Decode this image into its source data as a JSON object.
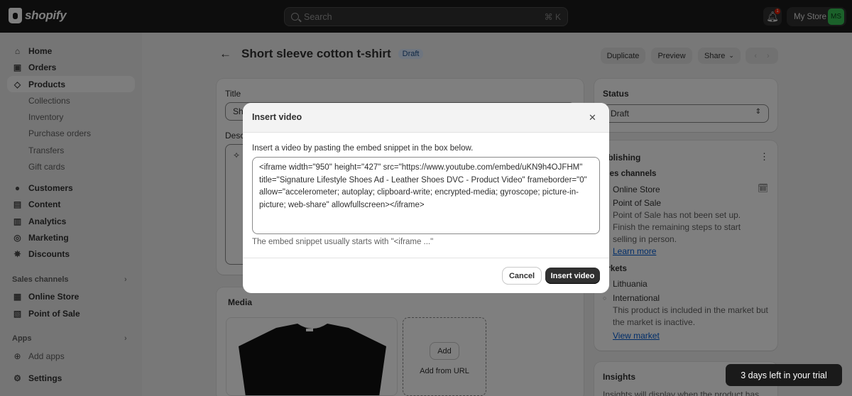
{
  "topbar": {
    "brand": "shopify",
    "search_placeholder": "Search",
    "search_shortcut": "⌘ K",
    "notification_count": "1",
    "store_name": "My Store",
    "store_initials": "MS"
  },
  "sidebar": {
    "items": [
      {
        "label": "Home",
        "icon": "home-icon"
      },
      {
        "label": "Orders",
        "icon": "orders-icon"
      },
      {
        "label": "Products",
        "icon": "tag-icon"
      },
      {
        "label": "Collections"
      },
      {
        "label": "Inventory"
      },
      {
        "label": "Purchase orders"
      },
      {
        "label": "Transfers"
      },
      {
        "label": "Gift cards"
      },
      {
        "label": "Customers",
        "icon": "person-icon"
      },
      {
        "label": "Content",
        "icon": "content-icon"
      },
      {
        "label": "Analytics",
        "icon": "analytics-icon"
      },
      {
        "label": "Marketing",
        "icon": "target-icon"
      },
      {
        "label": "Discounts",
        "icon": "discount-icon"
      }
    ],
    "sales_channels_label": "Sales channels",
    "channels": [
      {
        "label": "Online Store",
        "icon": "store-icon"
      },
      {
        "label": "Point of Sale",
        "icon": "pos-icon"
      }
    ],
    "apps_label": "Apps",
    "add_apps": "Add apps",
    "settings": "Settings"
  },
  "page": {
    "title": "Short sleeve cotton t-shirt",
    "status_badge": "Draft",
    "duplicate": "Duplicate",
    "preview": "Preview",
    "share": "Share"
  },
  "product_card": {
    "title_label": "Title",
    "title_value_partial": "Sh",
    "description_label_partial": "Desc",
    "media_label": "Media",
    "add_button": "Add",
    "add_from_url": "Add from URL"
  },
  "status_card": {
    "label": "Status",
    "value": "Draft"
  },
  "publishing_card": {
    "label_partial": "ublishing",
    "sales_channels_partial": "ales channels",
    "online_store": "Online Store",
    "point_of_sale": "Point of Sale",
    "pos_note": "Point of Sale has not been set up. Finish the remaining steps to start selling in person.",
    "learn_more": "Learn more",
    "markets_partial": "arkets",
    "lithuania": "Lithuania",
    "international": "International",
    "intl_note": "This product is included in the market but the market is inactive.",
    "view_market": "View market"
  },
  "insights_card": {
    "label": "Insights",
    "note_partial": "Insights will display when the product has"
  },
  "modal": {
    "title": "Insert video",
    "description": "Insert a video by pasting the embed snippet in the box below.",
    "snippet": "<iframe width=\"950\" height=\"427\" src=\"https://www.youtube.com/embed/uKN9h4OJFHM\" title=\"Signature Lifestyle Shoes Ad - Leather Shoes DVC - Product Video\" frameborder=\"0\" allow=\"accelerometer; autoplay; clipboard-write; encrypted-media; gyroscope; picture-in-picture; web-share\" allowfullscreen></iframe>",
    "help": "The embed snippet usually starts with \"<iframe ...\"",
    "cancel": "Cancel",
    "insert": "Insert video"
  },
  "trial_banner": "3 days left in your trial"
}
